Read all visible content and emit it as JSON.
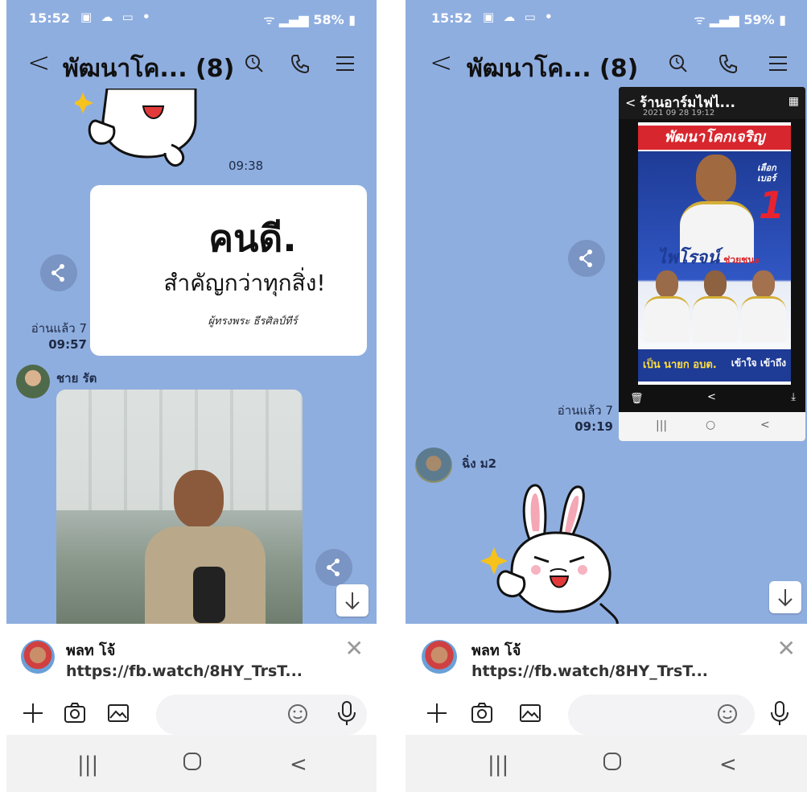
{
  "left": {
    "status": {
      "time": "15:52",
      "battery": "58%"
    },
    "header": {
      "title": "พัฒนาโค... (8)"
    },
    "messages": {
      "sticker_time": "09:38",
      "card_text_1": "คนดี.",
      "card_text_2": "สำคัญกว่าทุกสิ่ง!",
      "card_signature": "ผู้ทรงพระ ธีรศิลป์ทีร์",
      "read_label": "อ่านแล้ว 7",
      "read_time": "09:57",
      "sender_name": "ชาย รัต"
    },
    "announcement": {
      "name": "พลท โจ้",
      "link": "https://fb.watch/8HY_TrsT..."
    }
  },
  "right": {
    "status": {
      "time": "15:52",
      "battery": "59%"
    },
    "header": {
      "title": "พัฒนาโค... (8)"
    },
    "messages": {
      "shot_title": "ร้านอาร์มไฟไ...",
      "shot_date": "2021 09 28 19:12",
      "poster_banner": "พัฒนาโคกเจริญ",
      "poster_number_label": "เลือก เบอร์",
      "poster_number": "1",
      "poster_name": "ไพโรจน์",
      "poster_name_suffix": "ช่วยชนะ",
      "poster_slogan": "เป็น นายก อบต.",
      "poster_slogan_2": "เข้าใจ เข้าถึง",
      "read_label": "อ่านแล้ว 7",
      "read_time": "09:19",
      "sender_name": "ฉิ่ง ม2"
    },
    "announcement": {
      "name": "พลท โจ้",
      "link": "https://fb.watch/8HY_TrsT..."
    }
  },
  "colors": {
    "chat_bg": "#8faee0",
    "header_text": "#111111",
    "poster_banner": "#d8262e",
    "poster_bg": "#1e3b96"
  }
}
